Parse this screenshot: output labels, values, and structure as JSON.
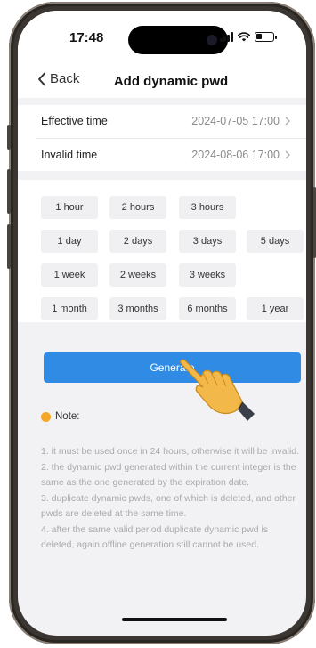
{
  "status_bar": {
    "time": "17:48"
  },
  "nav": {
    "back_label": "Back",
    "title": "Add dynamic pwd"
  },
  "time_settings": {
    "effective": {
      "label": "Effective time",
      "value": "2024-07-05 17:00"
    },
    "invalid": {
      "label": "Invalid time",
      "value": "2024-08-06 17:00"
    }
  },
  "durations": {
    "row1": [
      "1 hour",
      "2 hours",
      "3 hours"
    ],
    "row2": [
      "1 day",
      "2 days",
      "3 days",
      "5 days"
    ],
    "row3": [
      "1 week",
      "2 weeks",
      "3 weeks"
    ],
    "row4": [
      "1 month",
      "3 months",
      "6 months",
      "1 year"
    ]
  },
  "generate_label": "Generate",
  "note": {
    "title": "Note:",
    "lines": [
      "1. it must be used once in 24 hours, otherwise it will be invalid.",
      "2. the dynamic pwd generated within the current integer is the same as the one generated by the expiration date.",
      "3. duplicate dynamic pwds, one of which is deleted, and other pwds are deleted at the same time.",
      "4. after the same valid period duplicate dynamic pwd is deleted, again offline generation still cannot be used."
    ]
  },
  "colors": {
    "accent": "#2f8be3",
    "note_icon": "#f5a623",
    "hint_text": "#aaaaaa"
  }
}
